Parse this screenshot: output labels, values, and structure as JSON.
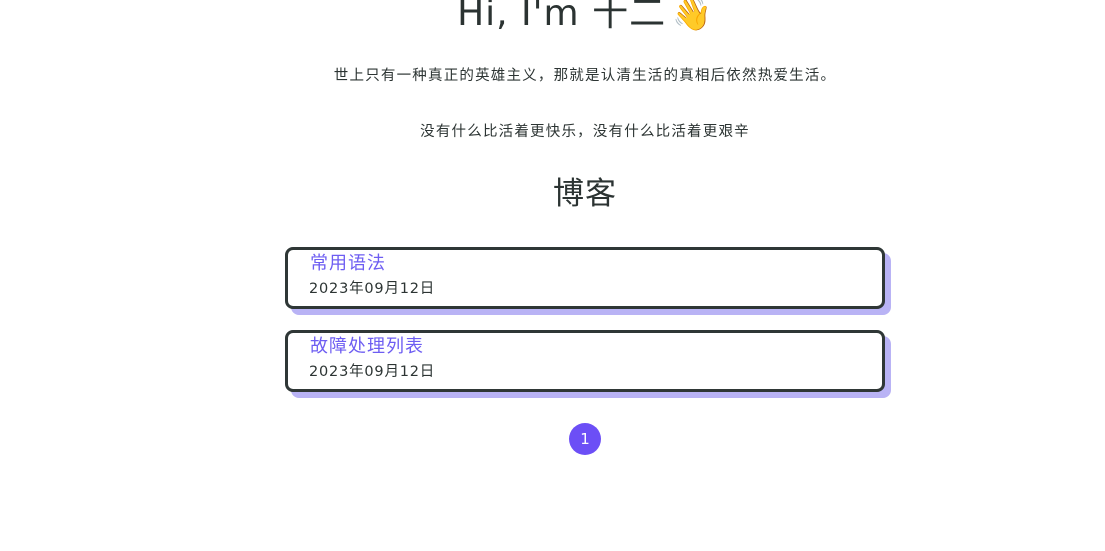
{
  "hero": {
    "title": "Hi, I'm 十二",
    "emoji": "👋"
  },
  "quotes": [
    "世上只有一种真正的英雄主义，那就是认清生活的真相后依然热爱生活。",
    "没有什么比活着更快乐，没有什么比活着更艰辛"
  ],
  "blog": {
    "section_title": "博客",
    "posts": [
      {
        "title": "常用语法",
        "date": "2023年09月12日"
      },
      {
        "title": "故障处理列表",
        "date": "2023年09月12日"
      }
    ]
  },
  "pagination": {
    "current_page": "1"
  },
  "colors": {
    "accent": "#6c4ff6",
    "link": "#6d5df2",
    "card_shadow": "#b9b3f5",
    "border": "#2f3736"
  }
}
